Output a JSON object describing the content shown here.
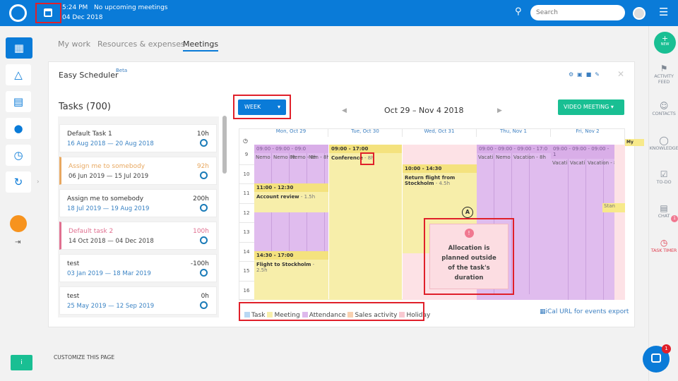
{
  "topbar": {
    "time": "5:24 PM",
    "meetings": "No upcoming meetings",
    "date": "04 Dec 2018",
    "search_placeholder": "Search"
  },
  "tabs": [
    "My work",
    "Resources & expenses",
    "Meetings"
  ],
  "panel": {
    "title": "Easy Scheduler",
    "beta": "Beta"
  },
  "tasks": {
    "title": "Tasks (700)",
    "items": [
      {
        "name": "Default Task 1",
        "dates": "16 Aug 2018  —  20 Aug 2018",
        "hours": "10h",
        "color": "#333333"
      },
      {
        "name": "Assign me to somebody",
        "dates": "06 Jun 2019  —  15 Jul 2019",
        "hours": "92h",
        "color": "#e8a860"
      },
      {
        "name": "Assign me to somebody",
        "dates": "18 Jul 2019  —  19 Aug 2019",
        "hours": "200h",
        "color": "#333333"
      },
      {
        "name": "Default task 2",
        "dates": "14 Oct 2018  —  04 Dec 2018",
        "hours": "100h",
        "color": "#e07090"
      },
      {
        "name": "test",
        "dates": "03 Jan 2019  —  18 Mar 2019",
        "hours": "-100h",
        "color": "#333333"
      },
      {
        "name": "test",
        "dates": "25 May 2019  —  12 Sep 2019",
        "hours": "0h",
        "color": "#333333"
      }
    ]
  },
  "calendar": {
    "view": "WEEK",
    "range": "Oct 29 – Nov 4 2018",
    "video_meeting": "VIDEO MEETING",
    "days": [
      "Mon, Oct 29",
      "Tue, Oct 30",
      "Wed, Oct 31",
      "Thu, Nov 1",
      "Fri, Nov 2"
    ],
    "hours": [
      "9",
      "10",
      "11",
      "12",
      "13",
      "14",
      "15",
      "16"
    ],
    "events": {
      "mon_att_head": "09:00 - 09:00 - 09:0",
      "mon_att": [
        "Nemo",
        "Nemo 8h",
        "Nemo - 8h",
        "Nen - 8h"
      ],
      "acc_time": "11:00 - 12:30",
      "acc_title": "Account review",
      "acc_dur": " - 1.5h",
      "fl_time": "14:30 - 17:00",
      "fl_title": "Flight to Stockholm",
      "fl_dur": " - 2.5h",
      "conf_time": "09:00 - 17:00",
      "conf_title": "Conference",
      "conf_dur": " - 8h",
      "ret_time": "10:00 - 14:30",
      "ret_title": "Return flight from Stockholm",
      "ret_dur": " - 4.5h",
      "thu_head": "09:00 - 09:00 - 09:00 - 17:0",
      "thu": [
        "Vacati",
        "Nemo",
        "Vacation - 8h"
      ],
      "fri_head": "09:00 - 09:00 - 09:00 - 1",
      "fri": [
        "Vacati",
        "Vacati",
        "Vacation - 8h"
      ],
      "stan": "Stan",
      "my": "My"
    },
    "tooltip": "Allocation is planned outside of the task's duration",
    "marker": "A",
    "legend": [
      {
        "label": "Task",
        "color": "#b8d8f4"
      },
      {
        "label": "Meeting",
        "color": "#f7eeaa"
      },
      {
        "label": "Attendance",
        "color": "#ddb8ec"
      },
      {
        "label": "Sales activity",
        "color": "#f8d0b0"
      },
      {
        "label": "Holiday",
        "color": "#f8c8d0"
      }
    ],
    "ical": "iCal URL for events export"
  },
  "customize": "CUSTOMIZE THIS PAGE",
  "rightnav": {
    "new": "NEW",
    "items": [
      "ACTIVITY FEED",
      "CONTACTS",
      "KNOWLEDGE",
      "TO-DO",
      "CHAT",
      "TASK TIMER"
    ],
    "timer_badge": "1"
  },
  "chat_badge": "1"
}
